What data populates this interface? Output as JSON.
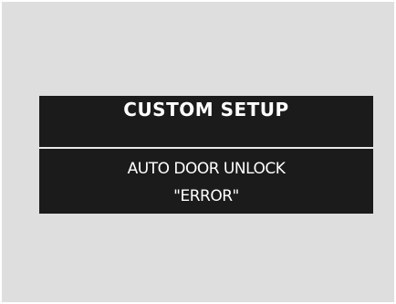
{
  "display": {
    "title": "CUSTOM SETUP",
    "item_label": "AUTO DOOR UNLOCK",
    "item_value": "\"ERROR\""
  },
  "colors": {
    "screen_background": "#dedede",
    "panel_background": "#1b1b1b",
    "text": "#ffffff"
  }
}
